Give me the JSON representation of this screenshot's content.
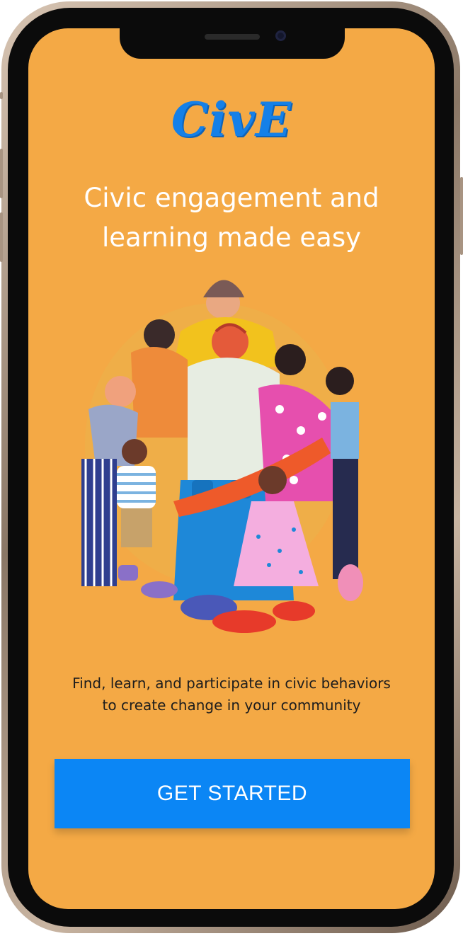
{
  "app": {
    "logo_text": "CivE",
    "headline": "Civic engagement and learning made easy",
    "description": "Find, learn, and participate in civic behaviors to create change in your community",
    "cta_label": "GET STARTED"
  },
  "hero_image": {
    "icon": "group-hug-illustration"
  },
  "colors": {
    "background": "#F4A945",
    "accent": "#0B86F5",
    "logo": "#1580E8",
    "headline": "#FFFFFF",
    "body_text": "#1D1D1D"
  }
}
